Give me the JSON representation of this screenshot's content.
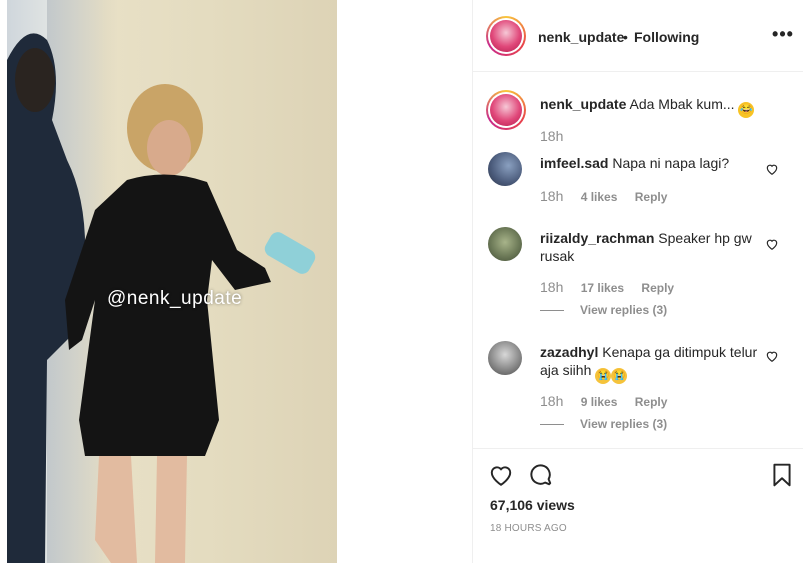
{
  "media": {
    "watermark": "@nenk_update"
  },
  "header": {
    "username": "nenk_update",
    "separator": "•",
    "follow_label": "Following",
    "more_label": "•••"
  },
  "caption": {
    "username": "nenk_update",
    "text": "Ada Mbak kum...",
    "emoji": "laughing-emoji",
    "time": "18h"
  },
  "comments": [
    {
      "username": "imfeel.sad",
      "text": "Napa ni napa lagi?",
      "time": "18h",
      "likes": "4 likes",
      "reply": "Reply"
    },
    {
      "username": "riizaldy_rachman",
      "text": "Speaker hp gw rusak",
      "time": "18h",
      "likes": "17 likes",
      "reply": "Reply",
      "view_replies": "View replies (3)"
    },
    {
      "username": "zazadhyl",
      "text": "Kenapa ga ditimpuk telur aja siihh",
      "emoji": "crying-emoji",
      "time": "18h",
      "likes": "9 likes",
      "reply": "Reply",
      "view_replies": "View replies (3)"
    }
  ],
  "post": {
    "views": "67,106 views",
    "posted": "18 HOURS AGO"
  },
  "colors": {
    "text": "#262626",
    "muted": "#8e8e8e",
    "border": "#efefef"
  }
}
